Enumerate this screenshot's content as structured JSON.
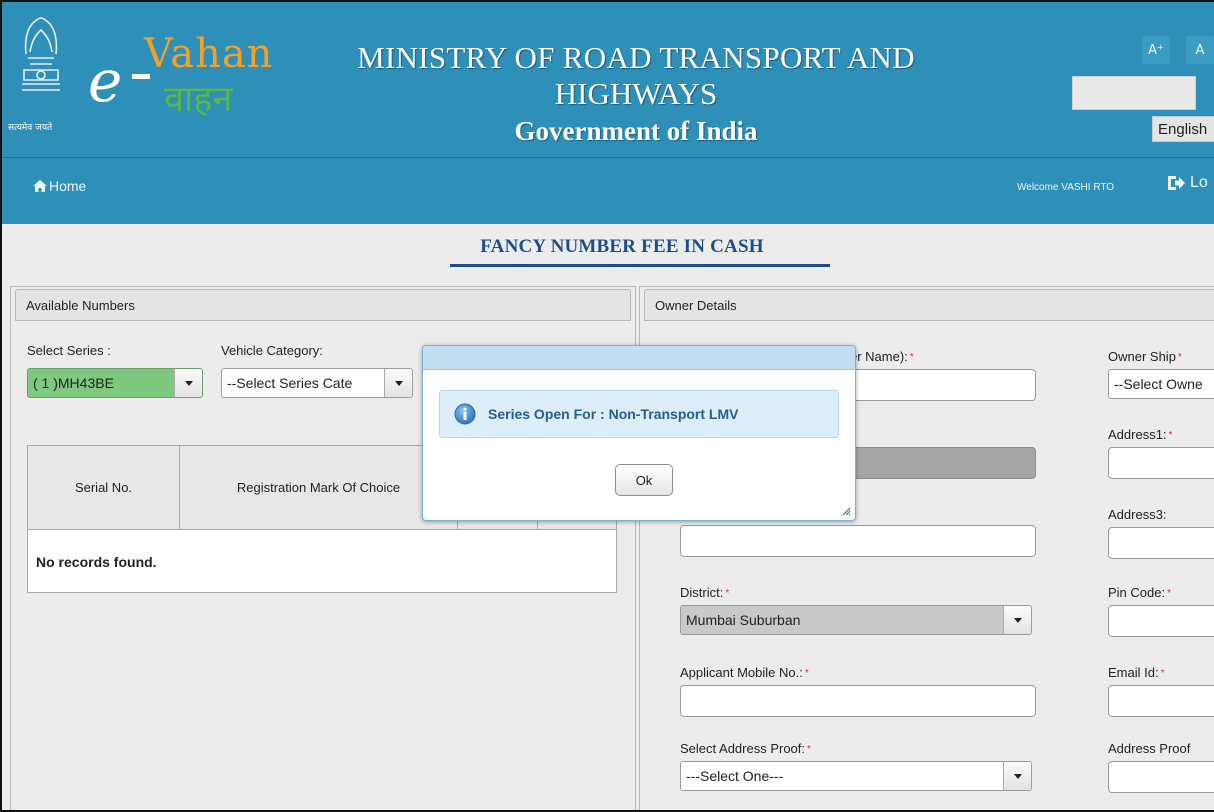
{
  "header": {
    "emblem_text": "सत्यमेव जयते",
    "logo_e": "e",
    "logo_vahan": "Vahan",
    "logo_hindi": "वाहन",
    "ministry_line1": "MINISTRY OF ROAD TRANSPORT AND",
    "ministry_line2": "HIGHWAYS",
    "ministry_line3": "Government of India",
    "font_increase": "A⁺",
    "font_normal": "A",
    "language": "English"
  },
  "nav": {
    "home": "Home",
    "welcome": "Welcome VASHI RTO",
    "logout": "Lo"
  },
  "page": {
    "title": "FANCY NUMBER FEE IN CASH"
  },
  "left_panel": {
    "heading": "Available Numbers",
    "select_series_label": "Select Series :",
    "select_series_value": "( 1 )MH43BE",
    "vehicle_category_label": "Vehicle Category:",
    "vehicle_category_value": "--Select Series Cate",
    "table": {
      "columns": [
        "Serial No.",
        "Registration Mark Of Choice"
      ],
      "empty_message": "No records found."
    }
  },
  "right_panel": {
    "heading": "Owner Details",
    "owner_name_label_partial": "er Name):",
    "ownership_label": "Owner Ship",
    "ownership_value": "--Select Owne",
    "address1_label": "Address1:",
    "address3_label": "Address3:",
    "district_label": "District:",
    "district_value": "Mumbai Suburban",
    "pin_code_label": "Pin Code:",
    "mobile_label": "Applicant Mobile No.:",
    "email_label": "Email Id:",
    "address_proof_select_label": "Select Address Proof:",
    "address_proof_select_value": "---Select One---",
    "address_proof_label": "Address Proof"
  },
  "dialog": {
    "message": "Series Open For : Non-Transport LMV",
    "ok_label": "Ok"
  },
  "colors": {
    "header_bg": "#2e8fb8",
    "title_color": "#1b4f8a",
    "series_select_bg": "#7ec97f",
    "required_marker": "#d32f2f"
  }
}
